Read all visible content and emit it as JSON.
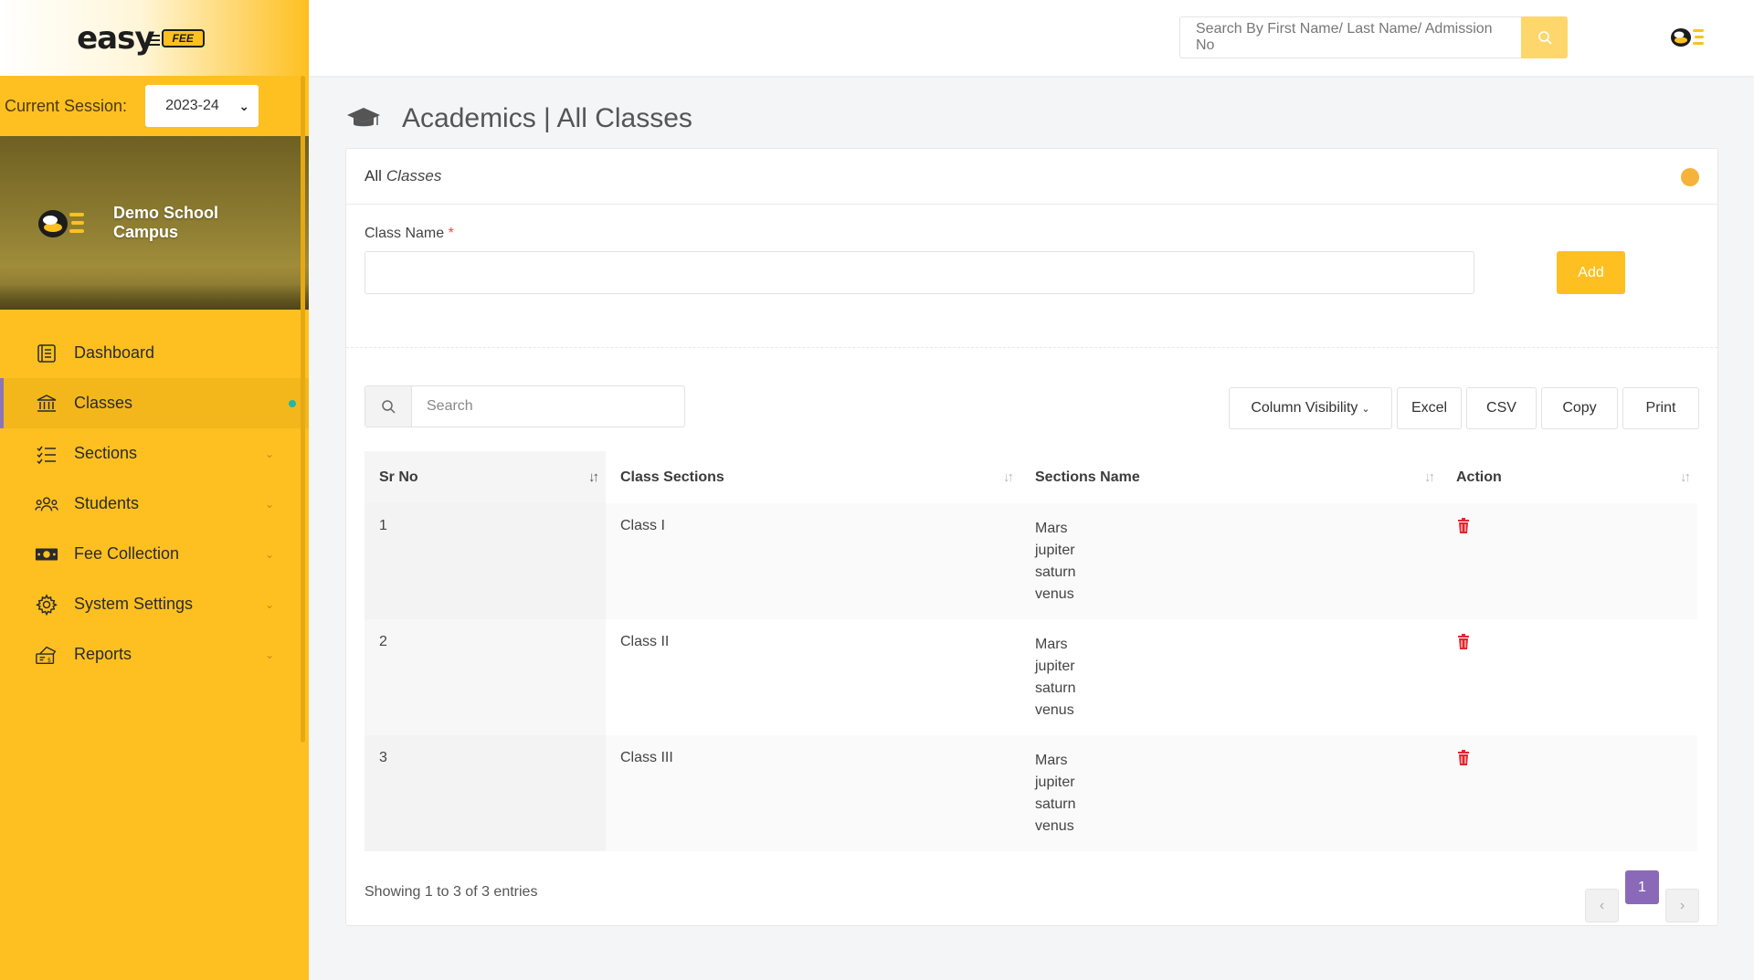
{
  "brand": {
    "name": "easy",
    "badge": "FEE"
  },
  "session": {
    "label": "Current Session:",
    "value": "2023-24"
  },
  "campus": {
    "name": "Demo School Campus"
  },
  "nav": [
    {
      "label": "Dashboard",
      "icon": "dashboard-icon",
      "active": false,
      "chevron": false
    },
    {
      "label": "Classes",
      "icon": "bank-icon",
      "active": true,
      "chevron": false
    },
    {
      "label": "Sections",
      "icon": "list-icon",
      "active": false,
      "chevron": true
    },
    {
      "label": "Students",
      "icon": "users-icon",
      "active": false,
      "chevron": true
    },
    {
      "label": "Fee Collection",
      "icon": "money-icon",
      "active": false,
      "chevron": true
    },
    {
      "label": "System Settings",
      "icon": "gear-icon",
      "active": false,
      "chevron": true
    },
    {
      "label": "Reports",
      "icon": "report-icon",
      "active": false,
      "chevron": true
    }
  ],
  "topbar": {
    "search_placeholder": "Search By First Name/ Last Name/ Admission No"
  },
  "page": {
    "title": "Academics | All Classes"
  },
  "card": {
    "title_strong": "All",
    "title_em": "Classes"
  },
  "form": {
    "class_label": "Class Name",
    "required_mark": "*",
    "add_label": "Add"
  },
  "table_tools": {
    "search_placeholder": "Search",
    "buttons": [
      "Column Visibility",
      "Excel",
      "CSV",
      "Copy",
      "Print"
    ]
  },
  "table": {
    "columns": [
      "Sr No",
      "Class Sections",
      "Sections Name",
      "Action"
    ],
    "rows": [
      {
        "sr": "1",
        "class": "Class I",
        "sections": [
          "Mars",
          "jupiter",
          "saturn",
          "venus"
        ]
      },
      {
        "sr": "2",
        "class": "Class II",
        "sections": [
          "Mars",
          "jupiter",
          "saturn",
          "venus"
        ]
      },
      {
        "sr": "3",
        "class": "Class III",
        "sections": [
          "Mars",
          "jupiter",
          "saturn",
          "venus"
        ]
      }
    ]
  },
  "footer": {
    "info": "Showing 1 to 3 of 3 entries",
    "current_page": "1"
  },
  "colors": {
    "accent": "#fec021",
    "pager_active": "#8a6ab8",
    "danger": "#e3262f"
  }
}
